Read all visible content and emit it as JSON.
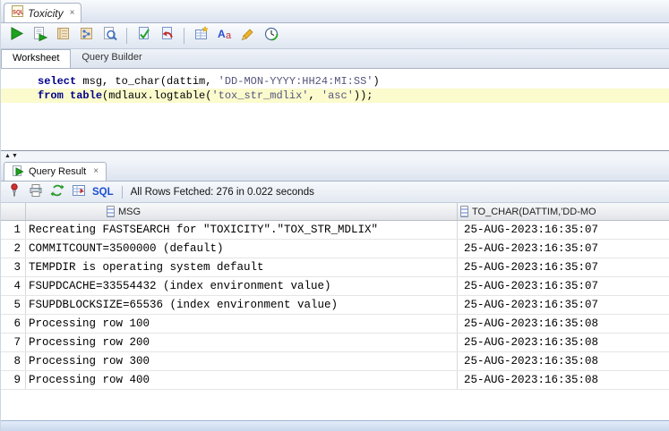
{
  "icons": {
    "close": "×",
    "collapse_up": "▲",
    "collapse_down": "▼",
    "toolbar_icon_names": [
      "run-icon",
      "run-script-icon",
      "autotrace-icon",
      "explain-plan-icon",
      "sql-tuning-icon",
      "commit-icon",
      "rollback-icon",
      "unshared-worksheet-icon",
      "change-case-icon",
      "clear-icon",
      "sql-history-icon"
    ],
    "result_toolbar_icon_names": [
      "pin-icon",
      "printer-icon",
      "refresh-icon",
      "fetch-all-icon"
    ]
  },
  "colors": {
    "keyword": "#00008b",
    "string": "#55557d",
    "line_highlight": "#fbfbcd",
    "sql_link": "#1a4fd1",
    "run_green": "#1fa21f",
    "pin_red": "#d23030"
  },
  "doc_tab": {
    "title": "Toxicity"
  },
  "worksheet_tabs": {
    "worksheet": "Worksheet",
    "query_builder": "Query Builder"
  },
  "editor": {
    "line1": {
      "kw1": "select",
      "code1": " msg, to_char(dattim, ",
      "str1": "'DD-MON-YYYY:HH24:MI:SS'",
      "code2": ")"
    },
    "line2": {
      "kw1": "from",
      "code1": " ",
      "kw2": "table",
      "code2": "(mdlaux.logtable(",
      "str1": "'tox_str_mdlix'",
      "code3": ", ",
      "str2": "'asc'",
      "code4": "));"
    }
  },
  "query_result": {
    "tab_title": "Query Result",
    "sql_label": "SQL",
    "status": "All Rows Fetched: 276 in 0.022 seconds"
  },
  "grid": {
    "columns": [
      {
        "label": "MSG"
      },
      {
        "label": "TO_CHAR(DATTIM,'DD-MO"
      }
    ],
    "rows": [
      {
        "num": "1",
        "msg": "Recreating FASTSEARCH for \"TOXICITY\".\"TOX_STR_MDLIX\"",
        "time": "25-AUG-2023:16:35:07"
      },
      {
        "num": "2",
        "msg": "COMMITCOUNT=3500000 (default)",
        "time": "25-AUG-2023:16:35:07"
      },
      {
        "num": "3",
        "msg": "TEMPDIR is operating system default",
        "time": "25-AUG-2023:16:35:07"
      },
      {
        "num": "4",
        "msg": "FSUPDCACHE=33554432 (index environment value)",
        "time": "25-AUG-2023:16:35:07"
      },
      {
        "num": "5",
        "msg": "FSUPDBLOCKSIZE=65536 (index environment value)",
        "time": "25-AUG-2023:16:35:07"
      },
      {
        "num": "6",
        "msg": "Processing row 100",
        "time": "25-AUG-2023:16:35:08"
      },
      {
        "num": "7",
        "msg": "Processing row 200",
        "time": "25-AUG-2023:16:35:08"
      },
      {
        "num": "8",
        "msg": "Processing row 300",
        "time": "25-AUG-2023:16:35:08"
      },
      {
        "num": "9",
        "msg": "Processing row 400",
        "time": "25-AUG-2023:16:35:08"
      }
    ]
  }
}
